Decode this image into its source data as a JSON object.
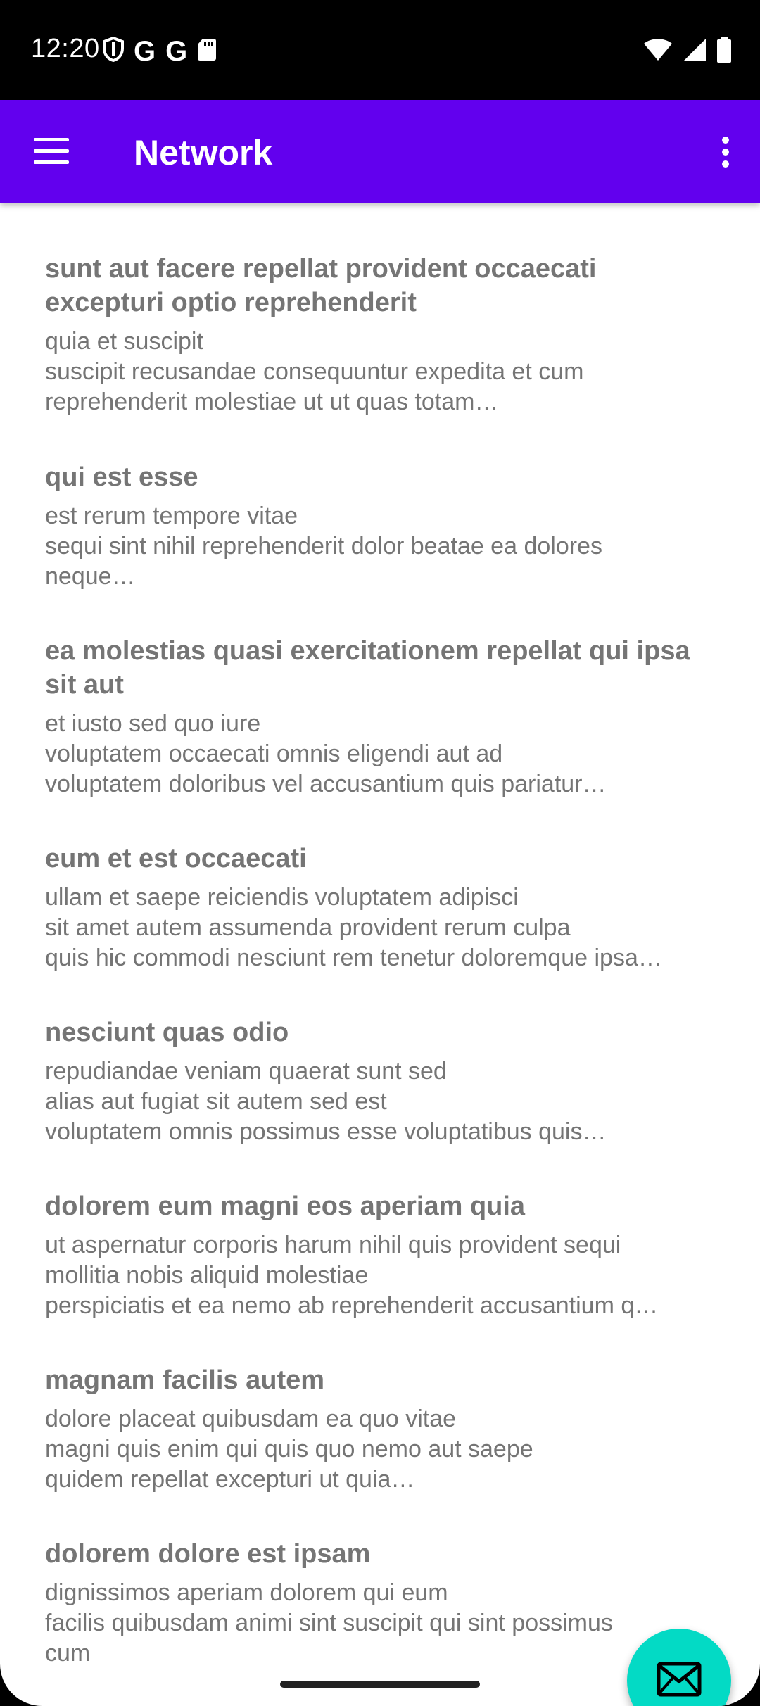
{
  "status_bar": {
    "time": "12:20",
    "left_icons": [
      "shield-icon",
      "google-icon",
      "google-icon",
      "sd-card-icon"
    ],
    "right_icons": [
      "wifi-icon",
      "signal-icon",
      "battery-icon"
    ]
  },
  "app_bar": {
    "title": "Network",
    "background": "#6200EE",
    "menu_icon": "hamburger-menu-icon",
    "overflow_icon": "more-vert-icon"
  },
  "posts": [
    {
      "title": "sunt aut facere repellat provident occaecati excepturi optio reprehenderit",
      "body": "quia et suscipit\nsuscipit recusandae consequuntur expedita et cum\nreprehenderit molestiae ut ut quas totam…"
    },
    {
      "title": "qui est esse",
      "body": "est rerum tempore vitae\nsequi sint nihil reprehenderit dolor beatae ea dolores\nneque…"
    },
    {
      "title": "ea molestias quasi exercitationem repellat qui ipsa sit aut",
      "body": "et iusto sed quo iure\nvoluptatem occaecati omnis eligendi aut ad\nvoluptatem doloribus vel accusantium quis pariatur…"
    },
    {
      "title": "eum et est occaecati",
      "body": "ullam et saepe reiciendis voluptatem adipisci\nsit amet autem assumenda provident rerum culpa\nquis hic commodi nesciunt rem tenetur doloremque ipsa…"
    },
    {
      "title": "nesciunt quas odio",
      "body": "repudiandae veniam quaerat sunt sed\nalias aut fugiat sit autem sed est\nvoluptatem omnis possimus esse voluptatibus quis…"
    },
    {
      "title": "dolorem eum magni eos aperiam quia",
      "body": "ut aspernatur corporis harum nihil quis provident sequi\nmollitia nobis aliquid molestiae\nperspiciatis et ea nemo ab reprehenderit accusantium q…"
    },
    {
      "title": "magnam facilis autem",
      "body": "dolore placeat quibusdam ea quo vitae\nmagni quis enim qui quis quo nemo aut saepe\nquidem repellat excepturi ut quia…"
    },
    {
      "title": "dolorem dolore est ipsam",
      "body": "dignissimos aperiam dolorem qui eum\nfacilis quibusdam animi sint suscipit qui sint possimus\ncum"
    }
  ],
  "fab": {
    "icon": "email-icon",
    "background": "#03DAC5"
  }
}
